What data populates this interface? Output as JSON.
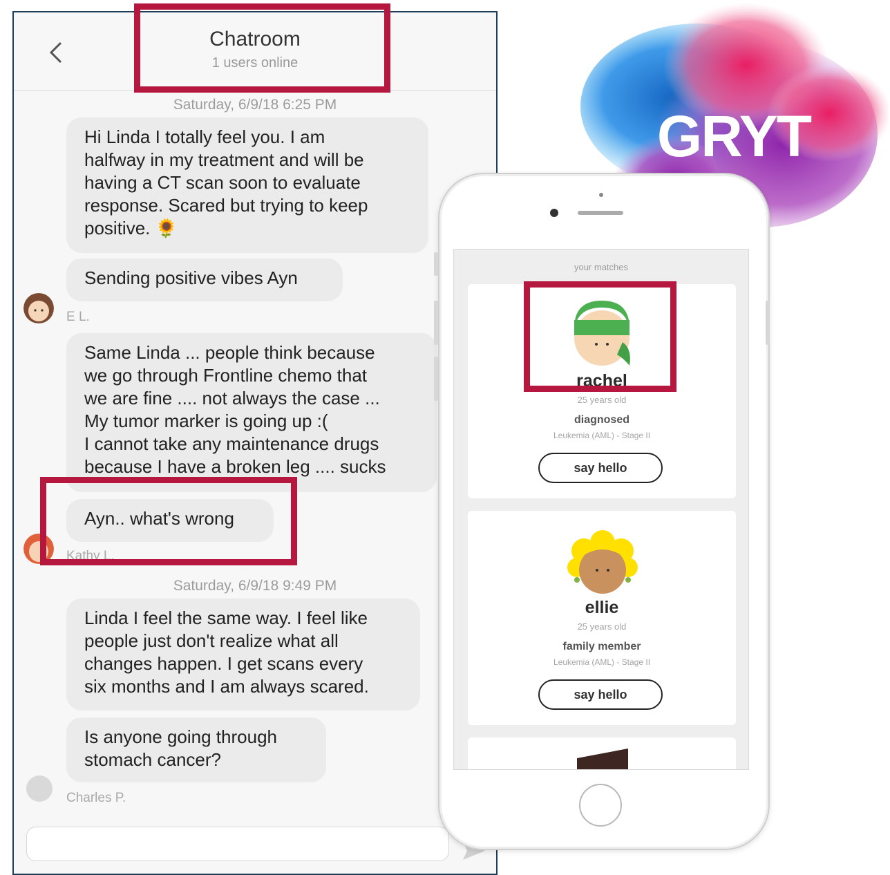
{
  "chat": {
    "title": "Chatroom",
    "subtitle": "1 users online",
    "back_icon": "chevron-left-icon",
    "timestamps": [
      "Saturday, 6/9/18 6:25 PM",
      "Saturday, 6/9/18 9:49 PM"
    ],
    "messages": [
      {
        "text": "Hi Linda I totally feel you. I am\nhalfway in my treatment and will be\nhaving a CT scan soon to evaluate\nresponse. Scared but trying to keep\npositive. 🌻"
      },
      {
        "text": "Sending positive vibes Ayn",
        "sender": "E L."
      },
      {
        "text": "Same Linda ... people think because\nwe go through Frontline chemo that\nwe are fine .... not always the case ...\nMy tumor marker is going up :(\nI cannot take any maintenance drugs\nbecause I have a broken leg .... sucks"
      },
      {
        "text": "Ayn.. what's wrong",
        "sender": "Kathy L."
      },
      {
        "text": "Linda I feel the same way. I feel like\npeople just don't realize what all\nchanges happen. I get scans every\nsix months and I am always scared."
      },
      {
        "text": "Is anyone going through\nstomach cancer?",
        "sender": "Charles P."
      }
    ],
    "input_placeholder": "",
    "send_icon": "send-icon"
  },
  "logo": {
    "text": "GRYT",
    "colors": [
      "#1e88e5",
      "#8e24aa",
      "#e91e63"
    ]
  },
  "phone": {
    "section_title": "your matches",
    "matches": [
      {
        "name": "rachel",
        "age": "25 years old",
        "role": "diagnosed",
        "diagnosis": "Leukemia (AML) - Stage II",
        "button": "say hello",
        "hat_color": "#4caf50"
      },
      {
        "name": "ellie",
        "age": "25 years old",
        "role": "family member",
        "diagnosis": "Leukemia (AML) - Stage II",
        "button": "say hello",
        "hair_color": "#ffe000"
      }
    ]
  },
  "colors": {
    "highlight": "#b5173e",
    "panel_border": "#1e3f5a",
    "bubble": "#ebebeb"
  }
}
